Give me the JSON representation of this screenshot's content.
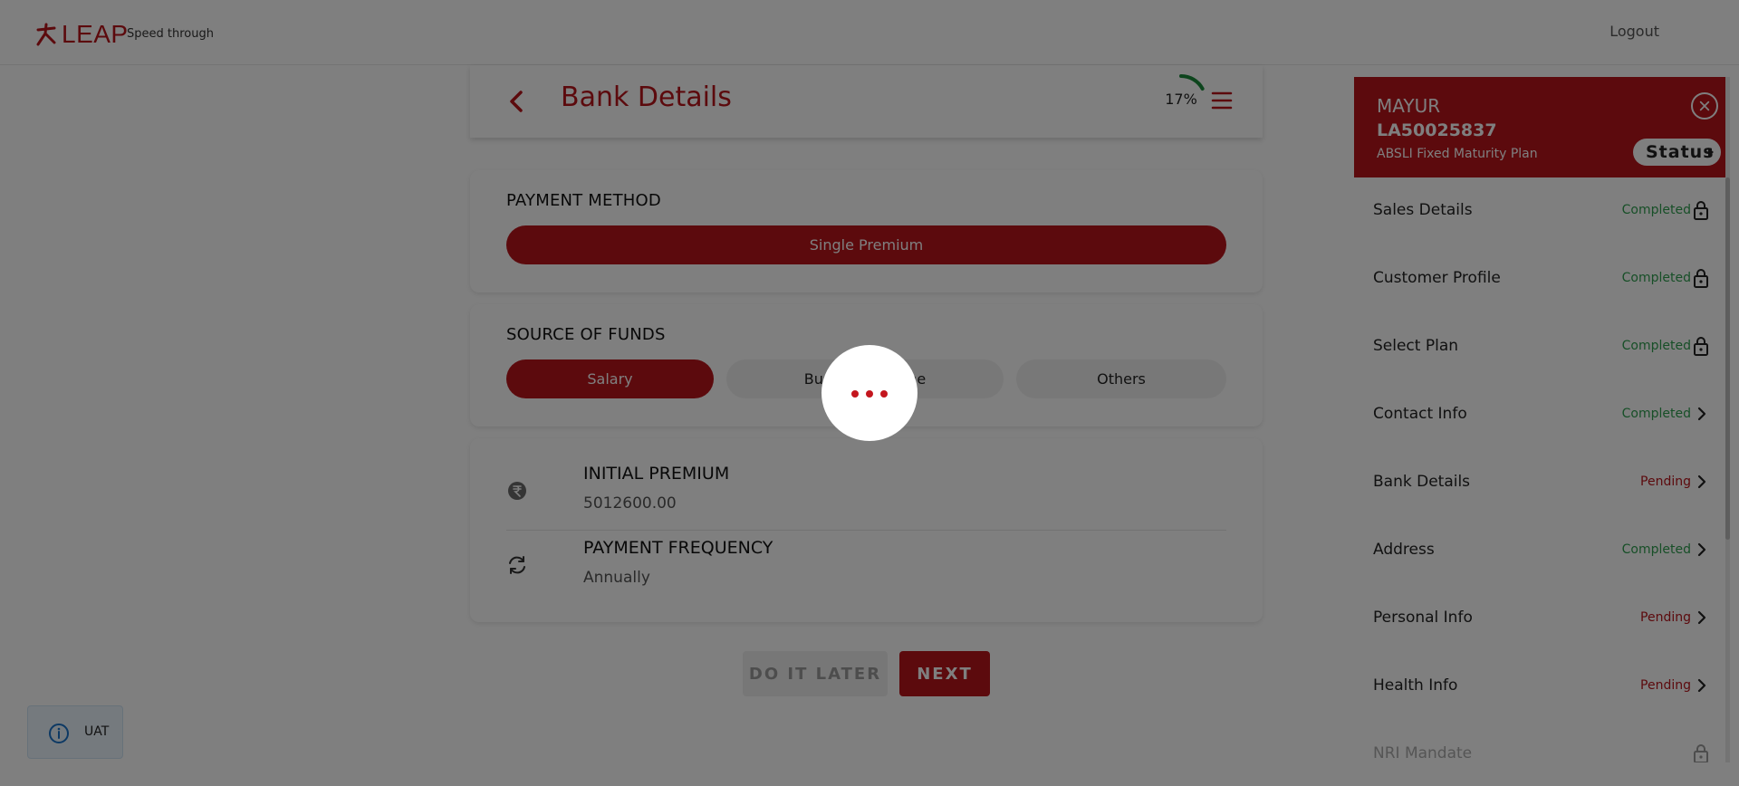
{
  "header": {
    "logo_text": "LEAP",
    "tagline": "Speed through",
    "logout_label": "Logout"
  },
  "form": {
    "title": "Bank Details",
    "progress_percent": 17,
    "progress_label": "17%",
    "payment_method": {
      "label": "PAYMENT METHOD",
      "option": "Single Premium"
    },
    "source_of_funds": {
      "label": "SOURCE OF FUNDS",
      "options": [
        "Salary",
        "Business Income",
        "Others"
      ],
      "selected": "Salary"
    },
    "initial_premium": {
      "label": "INITIAL PREMIUM",
      "value": "5012600.00"
    },
    "payment_frequency": {
      "label": "PAYMENT FREQUENCY",
      "value": "Annually"
    },
    "buttons": {
      "later": "DO IT LATER",
      "next": "NEXT"
    }
  },
  "sidebar": {
    "name": "MAYUR",
    "id": "LA50025837",
    "plan": "ABSLI Fixed Maturity Plan",
    "status_label": "Status",
    "items": [
      {
        "label": "Sales Details",
        "status": "Completed",
        "icon": "lock-icon"
      },
      {
        "label": "Customer Profile",
        "status": "Completed",
        "icon": "lock-icon"
      },
      {
        "label": "Select Plan",
        "status": "Completed",
        "icon": "lock-icon"
      },
      {
        "label": "Contact Info",
        "status": "Completed",
        "icon": "chevron-right-icon"
      },
      {
        "label": "Bank Details",
        "status": "Pending",
        "icon": "chevron-right-icon"
      },
      {
        "label": "Address",
        "status": "Completed",
        "icon": "chevron-right-icon"
      },
      {
        "label": "Personal Info",
        "status": "Pending",
        "icon": "chevron-right-icon"
      },
      {
        "label": "Health Info",
        "status": "Pending",
        "icon": "chevron-right-icon"
      },
      {
        "label": "NRI Mandate",
        "status": "",
        "icon": "lock-icon"
      }
    ]
  },
  "env_badge": {
    "label": "UAT",
    "icon": "info-icon"
  },
  "colors": {
    "brand_red": "#b8141b",
    "completed_green": "#2e9e4f",
    "overlay": "rgba(0,0,0,0.5)"
  }
}
